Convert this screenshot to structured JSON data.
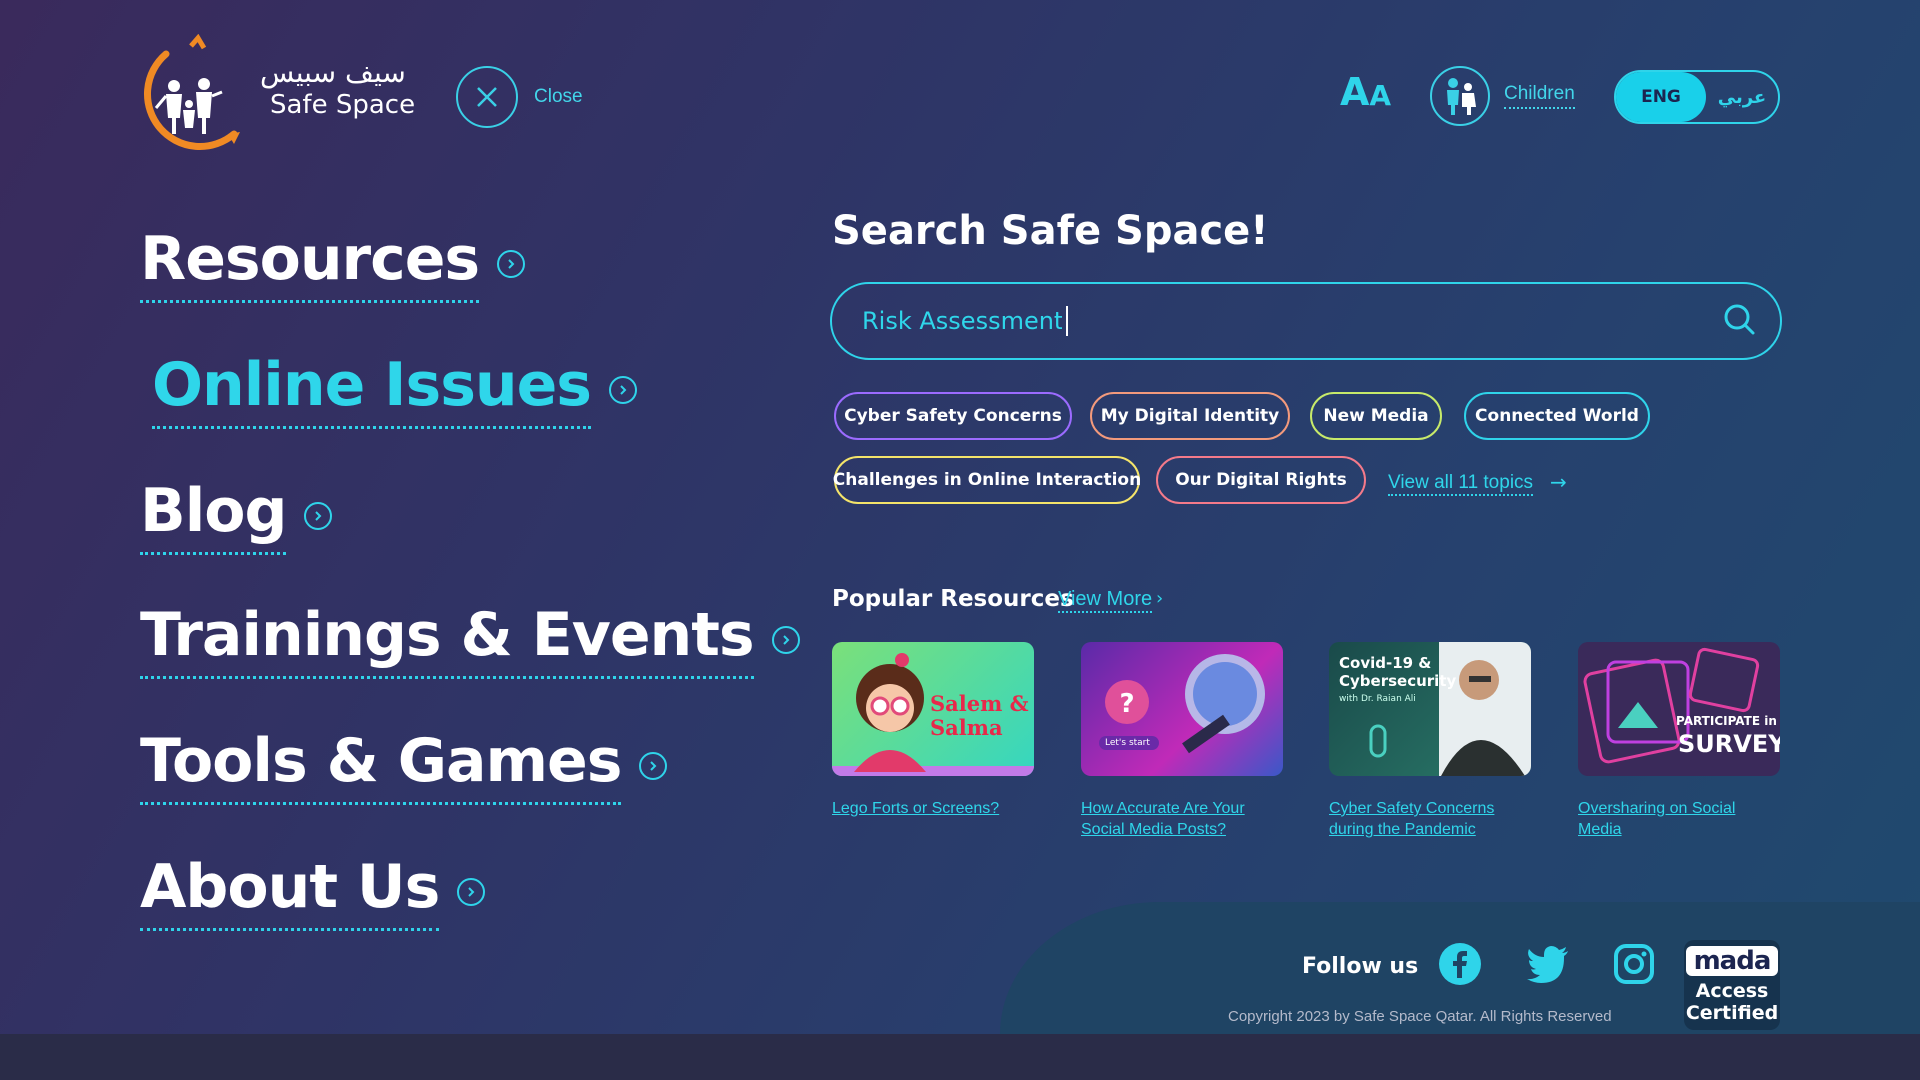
{
  "header": {
    "logo_arabic": "سيف سبيس",
    "logo_english": "Safe Space",
    "close_label": "Close",
    "font_size_label_big": "A",
    "font_size_label_small": "A",
    "children_label": "Children",
    "lang_eng": "ENG",
    "lang_ar": "عربي"
  },
  "nav": {
    "items": [
      {
        "label": "Resources",
        "active": false
      },
      {
        "label": "Online Issues",
        "active": true
      },
      {
        "label": "Blog",
        "active": false
      },
      {
        "label": "Trainings & Events",
        "active": false
      },
      {
        "label": "Tools & Games",
        "active": false
      },
      {
        "label": "About Us",
        "active": false
      }
    ]
  },
  "search": {
    "title": "Search Safe Space!",
    "value": "Risk Assessment",
    "topics": [
      {
        "label": "Cyber Safety Concerns",
        "color": "#9b6bff"
      },
      {
        "label": "My Digital Identity",
        "color": "#f39a7c"
      },
      {
        "label": "New Media",
        "color": "#c7ea6a"
      },
      {
        "label": "Connected World",
        "color": "#2fd4ea"
      },
      {
        "label": "Challenges in Online Interaction",
        "color": "#f4e46a"
      },
      {
        "label": "Our Digital Rights",
        "color": "#f47a8a"
      }
    ],
    "view_all": "View all 11 topics"
  },
  "popular": {
    "title": "Popular Resources",
    "view_more": "View More",
    "cards": [
      {
        "title": "Lego Forts or Screens?",
        "thumb_text": "Salem & Salma"
      },
      {
        "title": "How Accurate Are Your Social Media Posts?",
        "thumb_text": "Let's start"
      },
      {
        "title": "Cyber Safety Concerns during the Pandemic",
        "thumb_text": "Covid-19 & Cybersecurity",
        "thumb_sub": "with Dr. Raian Ali"
      },
      {
        "title": "Oversharing on Social Media",
        "thumb_text": "PARTICIPATE in",
        "thumb_text2": "SURVEY"
      }
    ]
  },
  "footer": {
    "follow_us": "Follow us",
    "copyright": "Copyright 2023 by Safe Space Qatar. All Rights Reserved",
    "mada_logo": "mada",
    "mada_text1": "Access",
    "mada_text2": "Certified",
    "icons": [
      "facebook-icon",
      "twitter-icon",
      "instagram-icon"
    ]
  },
  "colors": {
    "accent": "#2fd4ea",
    "logo_orange": "#f08a24"
  }
}
